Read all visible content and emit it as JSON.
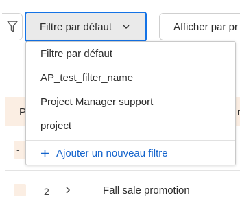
{
  "toolbar": {
    "filter_select_value": "Filtre par défaut",
    "afficher_label": "Afficher par pr"
  },
  "table": {
    "header_first": "P",
    "header_last": "r",
    "rows": [
      {
        "selector": "-"
      },
      {
        "selector": "",
        "number": "2",
        "name": "Fall sale promotion"
      }
    ]
  },
  "dropdown": {
    "options": [
      "Filtre par défaut",
      "AP_test_filter_name",
      "Project Manager support",
      "project"
    ],
    "add_label": "Ajouter un nouveau filtre"
  },
  "icons": {
    "filter": "funnel-icon",
    "chevron": "chevron-down-icon",
    "add": "plus-icon",
    "expand": "chevron-right-icon"
  },
  "colors": {
    "accent": "#1473e6",
    "link": "#1464cc",
    "header_bg": "#fbeee3"
  }
}
